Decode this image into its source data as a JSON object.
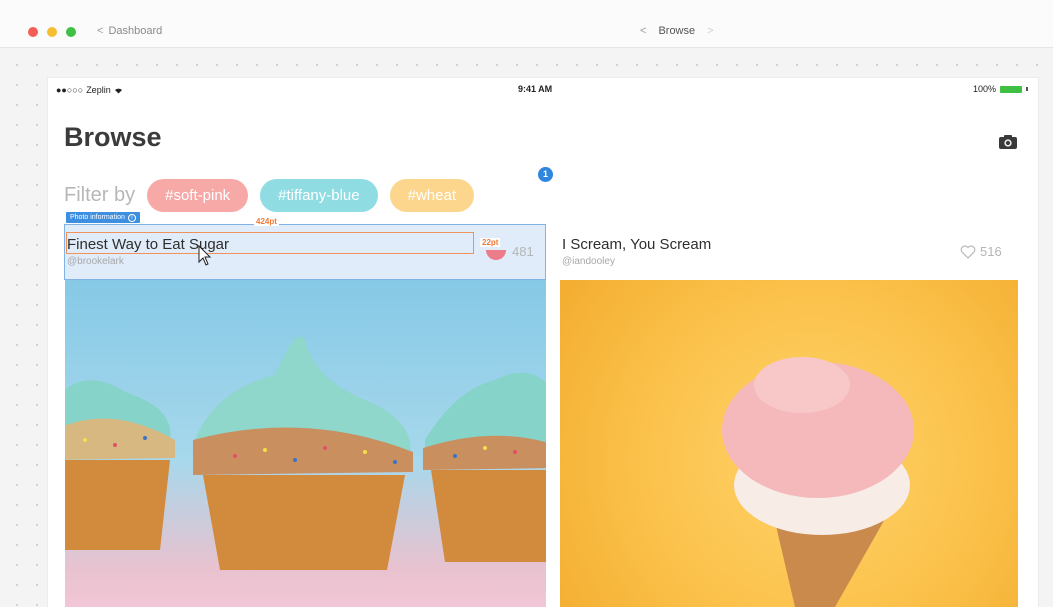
{
  "window": {
    "back_label": "Dashboard",
    "center_title": "Browse"
  },
  "status_bar": {
    "carrier": "Zeplin",
    "time": "9:41 AM",
    "battery": "100%"
  },
  "page": {
    "title": "Browse",
    "filter_label": "Filter by",
    "tags": [
      "#soft-pink",
      "#tiffany-blue",
      "#wheat"
    ],
    "notification_count": "1"
  },
  "inspector": {
    "layer_name": "Photo information",
    "width_label": "424pt",
    "height_label": "22pt"
  },
  "posts": [
    {
      "title": "Finest Way to Eat Sugar",
      "author": "@brookelark",
      "likes": "481"
    },
    {
      "title": "I Scream, You Scream",
      "author": "@iandooley",
      "likes": "516"
    }
  ],
  "colors": {
    "soft_pink": "#f7a9a8",
    "tiffany_blue": "#8fdde3",
    "wheat": "#fbd68c",
    "selection": "#3f8fe0",
    "measure": "#ef7a36"
  }
}
